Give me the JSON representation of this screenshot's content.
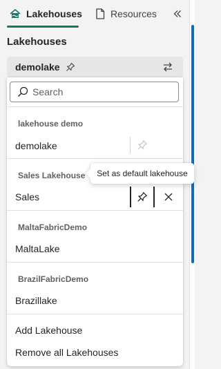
{
  "tabs": {
    "lakehouses_label": "Lakehouses",
    "resources_label": "Resources"
  },
  "panel": {
    "title": "Lakehouses"
  },
  "selector": {
    "current": "demolake"
  },
  "search": {
    "placeholder": "Search"
  },
  "groups": [
    {
      "header": "lakehouse demo",
      "item": "demolake"
    },
    {
      "header": "Sales Lakehouse",
      "item": "Sales"
    },
    {
      "header": "MaltaFabricDemo",
      "item": "MaltaLake"
    },
    {
      "header": "BrazilFabricDemo",
      "item": "Brazillake"
    }
  ],
  "actions": {
    "add": "Add Lakehouse",
    "remove_all": "Remove all Lakehouses"
  },
  "tooltip": {
    "text": "Set as default lakehouse"
  },
  "colors": {
    "accent_green": "#117865",
    "accent_blue": "#0f6cbd"
  },
  "icons": {
    "lakehouse_tab": "lakehouse-icon",
    "resources_tab": "document-icon",
    "collapse": "double-chevron-left-icon",
    "pin": "pin-icon",
    "swap": "swap-arrows-icon",
    "search": "search-icon",
    "close": "close-icon"
  }
}
